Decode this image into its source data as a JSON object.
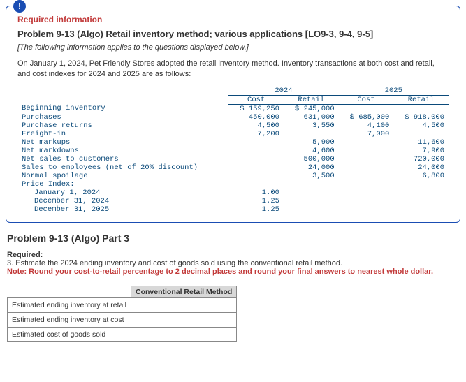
{
  "card": {
    "badge": "!",
    "required_info": "Required information",
    "title": "Problem 9-13 (Algo) Retail inventory method; various applications [LO9-3, 9-4, 9-5]",
    "italic_note": "[The following information applies to the questions displayed below.]",
    "body": "On January 1, 2024, Pet Friendly Stores adopted the retail inventory method. Inventory transactions at both cost and retail, and cost indexes for 2024 and 2025 are as follows:"
  },
  "table": {
    "year_a": "2024",
    "year_b": "2025",
    "cost": "Cost",
    "retail": "Retail",
    "rows": {
      "beg_inv": {
        "label": "Beginning inventory",
        "c24": "$ 159,250",
        "r24": "$ 245,000",
        "c25": "",
        "r25": ""
      },
      "purch": {
        "label": "Purchases",
        "c24": "450,000",
        "r24": "631,000",
        "c25": "$ 685,000",
        "r25": "$ 918,000"
      },
      "pret": {
        "label": "Purchase returns",
        "c24": "4,500",
        "r24": "3,550",
        "c25": "4,100",
        "r25": "4,500"
      },
      "freight": {
        "label": "Freight-in",
        "c24": "7,200",
        "r24": "",
        "c25": "7,000",
        "r25": ""
      },
      "markup": {
        "label": "Net markups",
        "c24": "",
        "r24": "5,900",
        "c25": "",
        "r25": "11,600"
      },
      "markdown": {
        "label": "Net markdowns",
        "c24": "",
        "r24": "4,600",
        "c25": "",
        "r25": "7,900"
      },
      "netsales": {
        "label": "Net sales to customers",
        "c24": "",
        "r24": "500,000",
        "c25": "",
        "r25": "720,000"
      },
      "empsales": {
        "label": "Sales to employees (net of 20% discount)",
        "c24": "",
        "r24": "24,000",
        "c25": "",
        "r25": "24,000"
      },
      "spoilage": {
        "label": "Normal spoilage",
        "c24": "",
        "r24": "3,500",
        "c25": "",
        "r25": "6,800"
      },
      "pindex": {
        "label": "Price Index:"
      },
      "pi1": {
        "label": "January 1, 2024",
        "val": "1.00"
      },
      "pi2": {
        "label": "December 31, 2024",
        "val": "1.25"
      },
      "pi3": {
        "label": "December 31, 2025",
        "val": "1.25"
      }
    }
  },
  "part": {
    "title": "Problem 9-13 (Algo) Part 3",
    "required": "Required:",
    "q": "3. Estimate the 2024 ending inventory and cost of goods sold using the conventional retail method.",
    "note": "Note: Round your cost-to-retail percentage to 2 decimal places and round your final answers to nearest whole dollar."
  },
  "answer": {
    "header": "Conventional Retail Method",
    "r1": "Estimated ending inventory at retail",
    "r2": "Estimated ending inventory at cost",
    "r3": "Estimated cost of goods sold"
  }
}
